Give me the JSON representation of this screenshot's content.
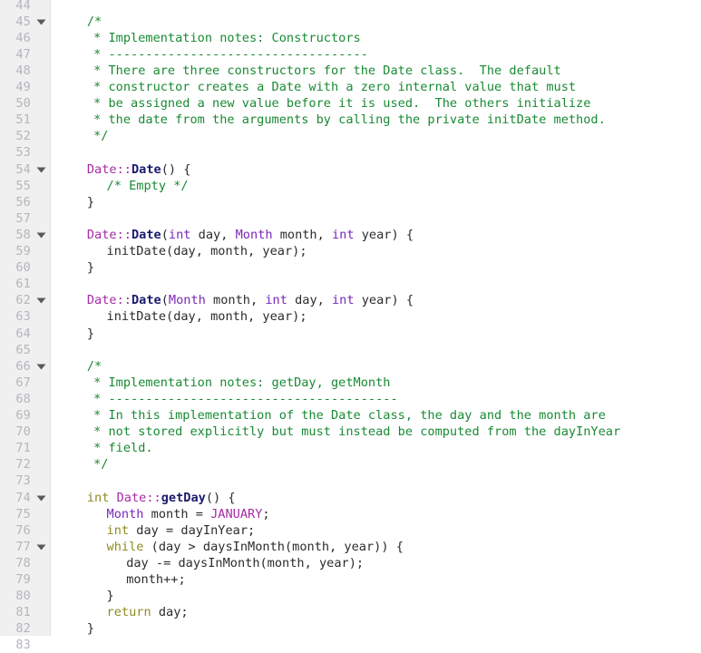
{
  "editor": {
    "language": "cpp",
    "first_visible_line": 44,
    "colors": {
      "background": "#ffffff",
      "gutter_background": "#f0f0f0",
      "gutter_border": "#e2e2e2",
      "line_number": "#b3b6bb",
      "comment": "#198a33",
      "keyword": "#8f8c24",
      "type": "#7a27b8",
      "class_scope": "#a62ba6",
      "function_name": "#1b1b6e",
      "constant": "#a62ba6",
      "plain_text": "#2b2b2b"
    },
    "fold_icon": "chevron-down-icon",
    "fold_lines": [
      45,
      54,
      58,
      62,
      66,
      74,
      77
    ],
    "lines": [
      {
        "n": 44,
        "indent": 0,
        "tokens": []
      },
      {
        "n": 45,
        "indent": 4,
        "tokens": [
          {
            "t": "/*",
            "c": "tk-com"
          }
        ]
      },
      {
        "n": 46,
        "indent": 5,
        "tokens": [
          {
            "t": "* Implementation notes: Constructors",
            "c": "tk-com"
          }
        ]
      },
      {
        "n": 47,
        "indent": 5,
        "tokens": [
          {
            "t": "* -----------------------------------",
            "c": "tk-com"
          }
        ]
      },
      {
        "n": 48,
        "indent": 5,
        "tokens": [
          {
            "t": "* There are three constructors for the Date class.  The default",
            "c": "tk-com"
          }
        ]
      },
      {
        "n": 49,
        "indent": 5,
        "tokens": [
          {
            "t": "* constructor creates a Date with a zero internal value that must",
            "c": "tk-com"
          }
        ]
      },
      {
        "n": 50,
        "indent": 5,
        "tokens": [
          {
            "t": "* be assigned a new value before it is used.  The others initialize",
            "c": "tk-com"
          }
        ]
      },
      {
        "n": 51,
        "indent": 5,
        "tokens": [
          {
            "t": "* the date from the arguments by calling the private initDate method.",
            "c": "tk-com"
          }
        ]
      },
      {
        "n": 52,
        "indent": 5,
        "tokens": [
          {
            "t": "*/",
            "c": "tk-com"
          }
        ]
      },
      {
        "n": 53,
        "indent": 0,
        "tokens": []
      },
      {
        "n": 54,
        "indent": 4,
        "tokens": [
          {
            "t": "Date::",
            "c": "tk-cls"
          },
          {
            "t": "Date",
            "c": "tk-fn"
          },
          {
            "t": "() {",
            "c": "tk-pun"
          }
        ]
      },
      {
        "n": 55,
        "indent": 7,
        "tokens": [
          {
            "t": "/* Empty */",
            "c": "tk-com"
          }
        ]
      },
      {
        "n": 56,
        "indent": 4,
        "tokens": [
          {
            "t": "}",
            "c": "tk-pun"
          }
        ]
      },
      {
        "n": 57,
        "indent": 0,
        "tokens": []
      },
      {
        "n": 58,
        "indent": 4,
        "tokens": [
          {
            "t": "Date::",
            "c": "tk-cls"
          },
          {
            "t": "Date",
            "c": "tk-fn"
          },
          {
            "t": "(",
            "c": "tk-pun"
          },
          {
            "t": "int",
            "c": "tk-typ"
          },
          {
            "t": " day, ",
            "c": "tk-pln"
          },
          {
            "t": "Month",
            "c": "tk-typ"
          },
          {
            "t": " month, ",
            "c": "tk-pln"
          },
          {
            "t": "int",
            "c": "tk-typ"
          },
          {
            "t": " year) {",
            "c": "tk-pln"
          }
        ]
      },
      {
        "n": 59,
        "indent": 7,
        "tokens": [
          {
            "t": "initDate(day, month, year);",
            "c": "tk-pln"
          }
        ]
      },
      {
        "n": 60,
        "indent": 4,
        "tokens": [
          {
            "t": "}",
            "c": "tk-pun"
          }
        ]
      },
      {
        "n": 61,
        "indent": 0,
        "tokens": []
      },
      {
        "n": 62,
        "indent": 4,
        "tokens": [
          {
            "t": "Date::",
            "c": "tk-cls"
          },
          {
            "t": "Date",
            "c": "tk-fn"
          },
          {
            "t": "(",
            "c": "tk-pun"
          },
          {
            "t": "Month",
            "c": "tk-typ"
          },
          {
            "t": " month, ",
            "c": "tk-pln"
          },
          {
            "t": "int",
            "c": "tk-typ"
          },
          {
            "t": " day, ",
            "c": "tk-pln"
          },
          {
            "t": "int",
            "c": "tk-typ"
          },
          {
            "t": " year) {",
            "c": "tk-pln"
          }
        ]
      },
      {
        "n": 63,
        "indent": 7,
        "tokens": [
          {
            "t": "initDate(day, month, year);",
            "c": "tk-pln"
          }
        ]
      },
      {
        "n": 64,
        "indent": 4,
        "tokens": [
          {
            "t": "}",
            "c": "tk-pun"
          }
        ]
      },
      {
        "n": 65,
        "indent": 0,
        "tokens": []
      },
      {
        "n": 66,
        "indent": 4,
        "tokens": [
          {
            "t": "/*",
            "c": "tk-com"
          }
        ]
      },
      {
        "n": 67,
        "indent": 5,
        "tokens": [
          {
            "t": "* Implementation notes: getDay, getMonth",
            "c": "tk-com"
          }
        ]
      },
      {
        "n": 68,
        "indent": 5,
        "tokens": [
          {
            "t": "* ---------------------------------------",
            "c": "tk-com"
          }
        ]
      },
      {
        "n": 69,
        "indent": 5,
        "tokens": [
          {
            "t": "* In this implementation of the Date class, the day and the month are",
            "c": "tk-com"
          }
        ]
      },
      {
        "n": 70,
        "indent": 5,
        "tokens": [
          {
            "t": "* not stored explicitly but must instead be computed from the dayInYear",
            "c": "tk-com"
          }
        ]
      },
      {
        "n": 71,
        "indent": 5,
        "tokens": [
          {
            "t": "* field.",
            "c": "tk-com"
          }
        ]
      },
      {
        "n": 72,
        "indent": 5,
        "tokens": [
          {
            "t": "*/",
            "c": "tk-com"
          }
        ]
      },
      {
        "n": 73,
        "indent": 0,
        "tokens": []
      },
      {
        "n": 74,
        "indent": 4,
        "tokens": [
          {
            "t": "int",
            "c": "tk-key"
          },
          {
            "t": " ",
            "c": "tk-pln"
          },
          {
            "t": "Date::",
            "c": "tk-cls"
          },
          {
            "t": "getDay",
            "c": "tk-fn"
          },
          {
            "t": "() {",
            "c": "tk-pun"
          }
        ]
      },
      {
        "n": 75,
        "indent": 7,
        "tokens": [
          {
            "t": "Month",
            "c": "tk-typ"
          },
          {
            "t": " month = ",
            "c": "tk-pln"
          },
          {
            "t": "JANUARY",
            "c": "tk-con"
          },
          {
            "t": ";",
            "c": "tk-pun"
          }
        ]
      },
      {
        "n": 76,
        "indent": 7,
        "tokens": [
          {
            "t": "int",
            "c": "tk-key"
          },
          {
            "t": " day = dayInYear;",
            "c": "tk-pln"
          }
        ]
      },
      {
        "n": 77,
        "indent": 7,
        "tokens": [
          {
            "t": "while",
            "c": "tk-key"
          },
          {
            "t": " (day > daysInMonth(month, year)) {",
            "c": "tk-pln"
          }
        ]
      },
      {
        "n": 78,
        "indent": 10,
        "tokens": [
          {
            "t": "day -= daysInMonth(month, year);",
            "c": "tk-pln"
          }
        ]
      },
      {
        "n": 79,
        "indent": 10,
        "tokens": [
          {
            "t": "month++;",
            "c": "tk-pln"
          }
        ]
      },
      {
        "n": 80,
        "indent": 7,
        "tokens": [
          {
            "t": "}",
            "c": "tk-pun"
          }
        ]
      },
      {
        "n": 81,
        "indent": 7,
        "tokens": [
          {
            "t": "return",
            "c": "tk-key"
          },
          {
            "t": " day;",
            "c": "tk-pln"
          }
        ]
      },
      {
        "n": 82,
        "indent": 4,
        "tokens": [
          {
            "t": "}",
            "c": "tk-pun"
          }
        ]
      },
      {
        "n": 83,
        "indent": 0,
        "tokens": []
      }
    ]
  }
}
